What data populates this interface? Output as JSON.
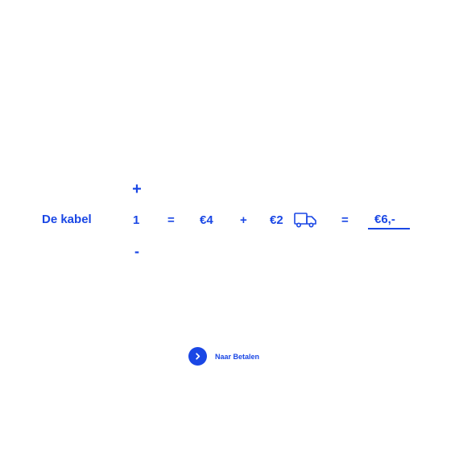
{
  "colors": {
    "accent": "#1a47e5",
    "background": "#ffffff"
  },
  "cart": {
    "product_name": "De kabel",
    "quantity": {
      "increment_label": "+",
      "value": "1",
      "decrement_label": "-"
    },
    "equals_symbol": "=",
    "unit_price": "€4",
    "plus_symbol": "+",
    "shipping_price": "€2",
    "shipping_icon": "truck-icon",
    "total_price": "€6,-"
  },
  "checkout": {
    "icon": "chevron-right-icon",
    "label": "Naar Betalen"
  }
}
